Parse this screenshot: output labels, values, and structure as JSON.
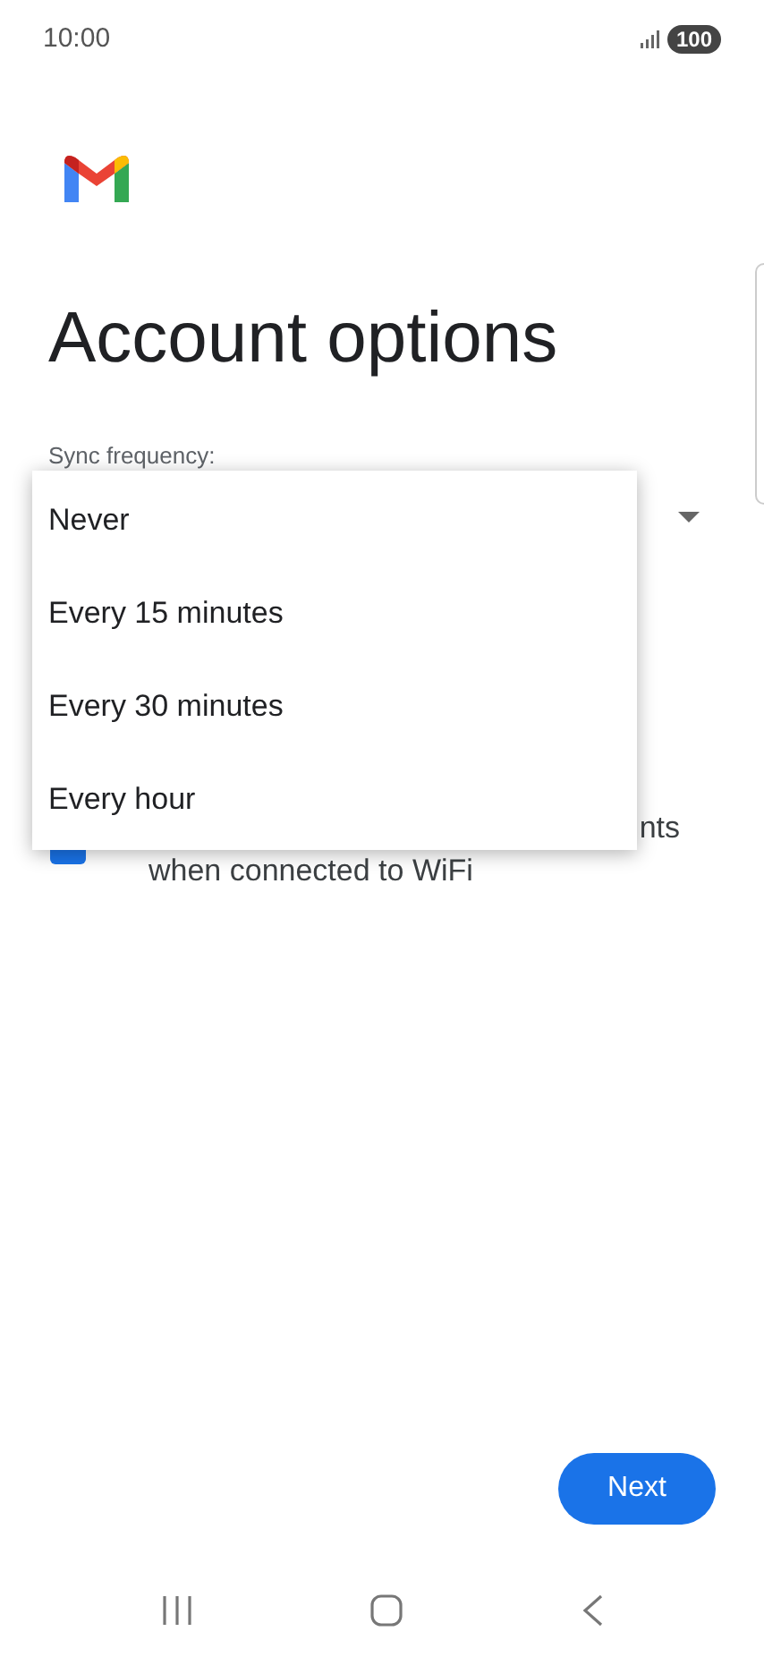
{
  "status_bar": {
    "time": "10:00",
    "battery": "100"
  },
  "title": "Account options",
  "sync_frequency": {
    "label": "Sync frequency:"
  },
  "menu": [
    {
      "label": "Never",
      "selected": false
    },
    {
      "label": "Every 15 minutes",
      "selected": false
    },
    {
      "label": "Every 30 minutes",
      "selected": false
    },
    {
      "label": "Every hour",
      "selected": false
    }
  ],
  "attachments_option": {
    "checked": true,
    "label_line_1_visible": "nts",
    "label_line_2": "when connected to WiFi"
  },
  "next_button": "Next"
}
